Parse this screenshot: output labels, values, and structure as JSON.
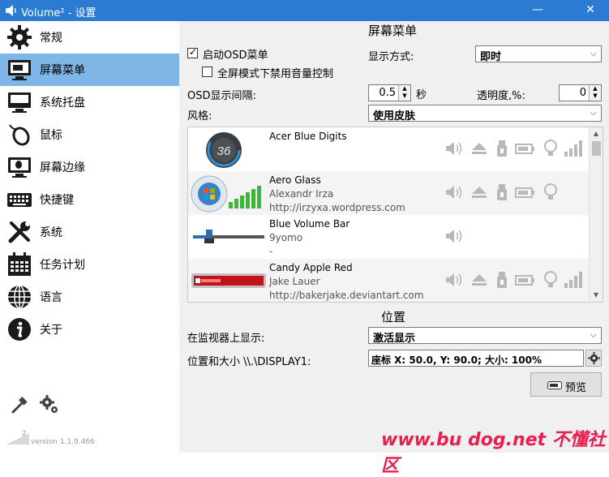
{
  "window": {
    "title": "Volume² - 设置",
    "minimize": "—",
    "close": "✕"
  },
  "sidebar": {
    "items": [
      {
        "label": "常规",
        "icon": "gear-icon"
      },
      {
        "label": "屏幕菜单",
        "icon": "monitor-icon",
        "active": true
      },
      {
        "label": "系统托盘",
        "icon": "tray-icon"
      },
      {
        "label": "鼠标",
        "icon": "mouse-icon"
      },
      {
        "label": "屏幕边缘",
        "icon": "screen-edge-icon"
      },
      {
        "label": "快捷键",
        "icon": "keyboard-icon"
      },
      {
        "label": "系统",
        "icon": "tools-icon"
      },
      {
        "label": "任务计划",
        "icon": "calendar-icon"
      },
      {
        "label": "语言",
        "icon": "globe-icon"
      },
      {
        "label": "关于",
        "icon": "info-icon"
      }
    ],
    "version_num": "2",
    "version": "version 1.1.9.466"
  },
  "osd": {
    "section_title": "屏幕菜单",
    "enable_label": "启动OSD菜单",
    "enable_checked": true,
    "fullscreen_label": "全屏模式下禁用音量控制",
    "fullscreen_checked": false,
    "display_mode_label": "显示方式:",
    "display_mode_value": "即时",
    "interval_label": "OSD显示间隔:",
    "interval_value": "0.5",
    "interval_unit": "秒",
    "opacity_label": "透明度,%:",
    "opacity_value": "0",
    "style_label": "风格:",
    "style_value": "使用皮肤"
  },
  "skins": [
    {
      "name": "Acer Blue Digits",
      "author": "",
      "url": "",
      "thumb_text": "36"
    },
    {
      "name": "Aero Glass",
      "author": "Alexandr Irza",
      "url": "http://irzyxa.wordpress.com"
    },
    {
      "name": "Blue Volume Bar",
      "author": "9yomo",
      "url": "-"
    },
    {
      "name": "Candy Apple Red",
      "author": "Jake Lauer",
      "url": "http://bakerjake.deviantart.com"
    }
  ],
  "position": {
    "section_title": "位置",
    "monitor_label": "在监视器上显示:",
    "monitor_value": "激活显示",
    "pos_size_label": "位置和大小 \\\\.\\DISPLAY1:",
    "pos_size_value": "座标 X: 50.0, Y: 90.0; 大小: 100%",
    "preview_label": "预览"
  },
  "watermark": "www.bu dog.net 不懂社区"
}
